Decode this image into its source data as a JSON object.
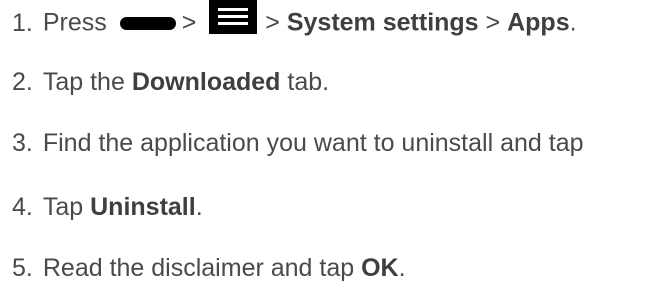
{
  "steps": [
    {
      "number": "1.",
      "parts": {
        "a": "Press",
        "sep1": ">",
        "sep2": ">",
        "b1": "System settings",
        "sep3": ">",
        "b2": "Apps",
        "end": "."
      },
      "icons": [
        "home-key-icon",
        "menu-key-icon"
      ]
    },
    {
      "number": "2.",
      "parts": {
        "a": "Tap the",
        "b1": "Downloaded",
        "c": "tab."
      }
    },
    {
      "number": "3.",
      "parts": {
        "a": "Find the application you want to uninstall and tap"
      }
    },
    {
      "number": "4.",
      "parts": {
        "a": "Tap",
        "b1": "Uninstall",
        "end": "."
      }
    },
    {
      "number": "5.",
      "parts": {
        "a": "Read the disclaimer and tap",
        "b1": "OK",
        "end": "."
      }
    }
  ],
  "colors": {
    "text": "#4a4a4a",
    "icon": "#000000",
    "background": "#ffffff"
  }
}
